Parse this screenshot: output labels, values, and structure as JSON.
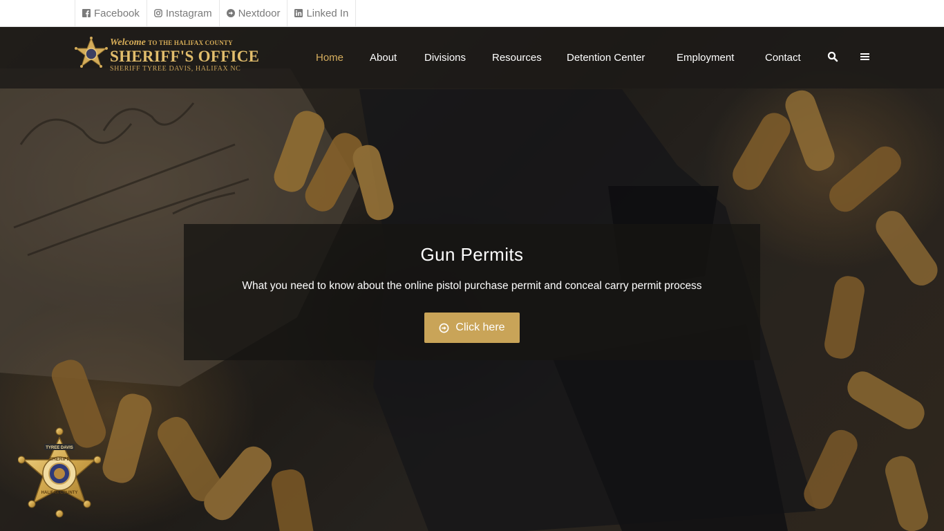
{
  "social": {
    "links": [
      {
        "label": "Facebook",
        "icon": "facebook-icon"
      },
      {
        "label": "Instagram",
        "icon": "instagram-icon"
      },
      {
        "label": "Nextdoor",
        "icon": "arrow-circle-right-icon"
      },
      {
        "label": "Linked In",
        "icon": "linkedin-icon"
      }
    ]
  },
  "logo": {
    "welcome": "Welcome",
    "welcome_rest": "TO THE HALIFAX COUNTY",
    "title": "SHERIFF'S OFFICE",
    "subtitle": "SHERIFF TYREE DAVIS, HALIFAX NC"
  },
  "nav": {
    "items": [
      {
        "label": "Home",
        "active": true
      },
      {
        "label": "About",
        "active": false
      },
      {
        "label": "Divisions",
        "active": false
      },
      {
        "label": "Resources",
        "active": false
      },
      {
        "label": "Detention Center",
        "active": false
      },
      {
        "label": "Employment",
        "active": false
      },
      {
        "label": "Contact",
        "active": false
      }
    ],
    "search_icon": "search-icon",
    "menu_icon": "hamburger-menu-icon"
  },
  "hero": {
    "title": "Gun Permits",
    "description": "What you need to know about the online pistol purchase permit and conceal carry permit process",
    "button_label": "Click here",
    "button_icon": "arrow-circle-right-icon"
  },
  "badge": {
    "top_text": "TYREE DAVIS",
    "center_text": "SHERIFF",
    "bottom_text": "HALIFAX COUNTY"
  },
  "colors": {
    "accent": "#c9a458",
    "active_nav": "#d6ae5e",
    "topbar_text": "#7a7a7a"
  }
}
